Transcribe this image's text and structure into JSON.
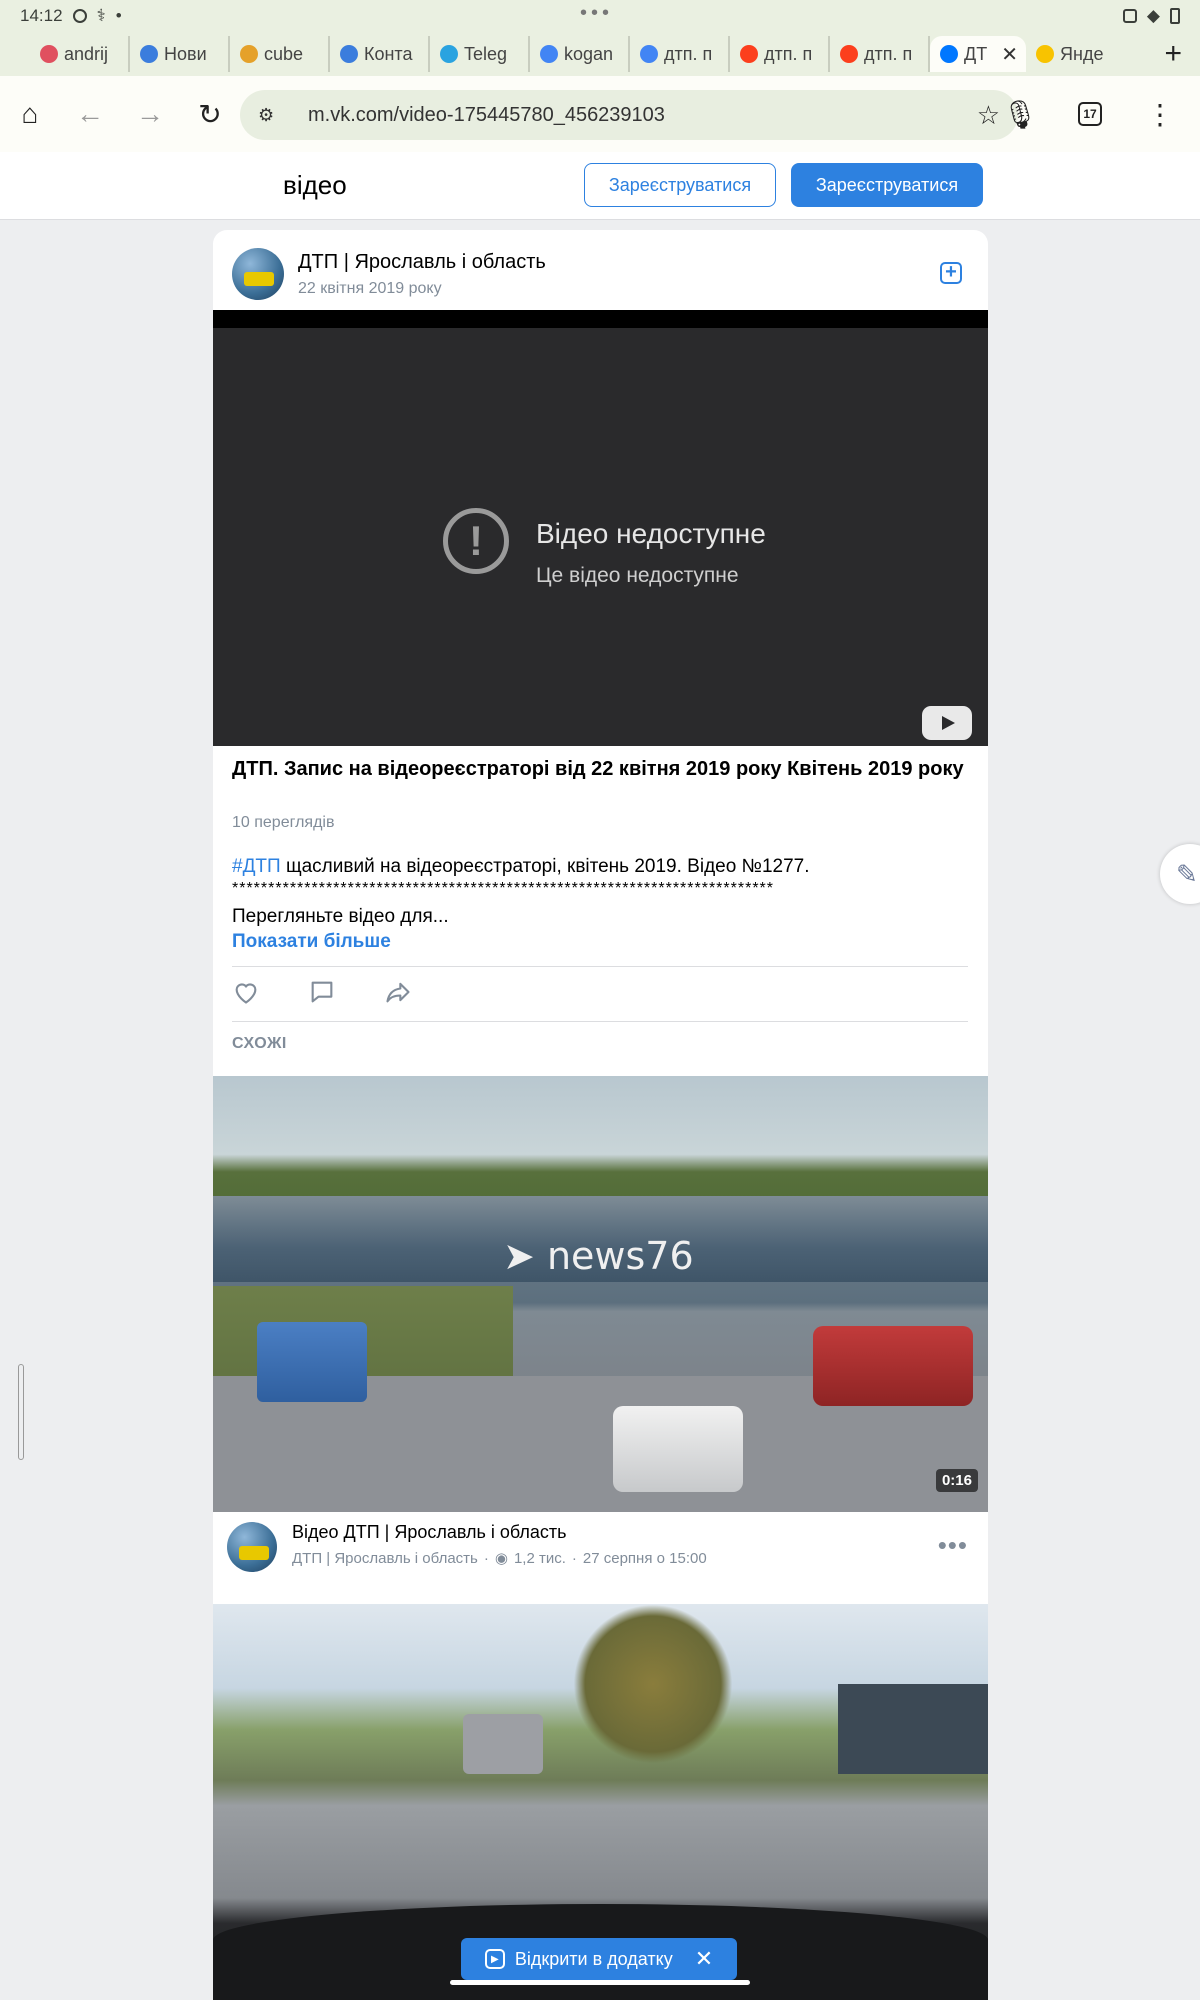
{
  "status": {
    "time": "14:12"
  },
  "browser": {
    "tabs": [
      {
        "label": "andrij",
        "color": "#e0505f"
      },
      {
        "label": "Нови",
        "color": "#3b7ddd"
      },
      {
        "label": "cube",
        "color": "#e5a12a"
      },
      {
        "label": "Конта",
        "color": "#3b7ddd"
      },
      {
        "label": "Teleg",
        "color": "#2aa3e0"
      },
      {
        "label": "kogan",
        "color": "#4285f4"
      },
      {
        "label": "дтп. п",
        "color": "#4285f4"
      },
      {
        "label": "дтп. п",
        "color": "#fc3f1d"
      },
      {
        "label": "дтп. п",
        "color": "#fc3f1d"
      },
      {
        "label": "ДТ",
        "color": "#0077ff"
      },
      {
        "label": "Янде",
        "color": "#f8c300"
      }
    ],
    "url": "m.vk.com/video-175445780_456239103",
    "tab_count": "17"
  },
  "header": {
    "title": "відео",
    "register_outline": "Зареєструватися",
    "register_fill": "Зареєструватися"
  },
  "video": {
    "owner": "ДТП | Ярославль і область",
    "date": "22 квітня 2019 року",
    "unavailable_title": "Відео недоступне",
    "unavailable_sub": "Це відео недоступне",
    "title": "ДТП. Запис на відеореєстраторі від 22 квітня 2019 року Квітень 2019 року",
    "views": "10 переглядів",
    "desc_tag": "#ДТП",
    "desc_text": " щасливий на відеореєстраторі, квітень 2019. Відео №1277.",
    "desc_stars": "***************************************************************************",
    "desc_more_text": "Перегляньте відео для...",
    "show_more": "Показати більше"
  },
  "similar": {
    "heading": "СХОЖІ",
    "items": [
      {
        "watermark": "news76",
        "duration": "0:16",
        "title": "Відео ДТП | Ярославль і область",
        "channel": "ДТП | Ярославль і область",
        "views": "1,2 тис.",
        "date": "27 серпня о 15:00"
      }
    ]
  },
  "banner": {
    "open_app": "Відкрити в додатку"
  }
}
